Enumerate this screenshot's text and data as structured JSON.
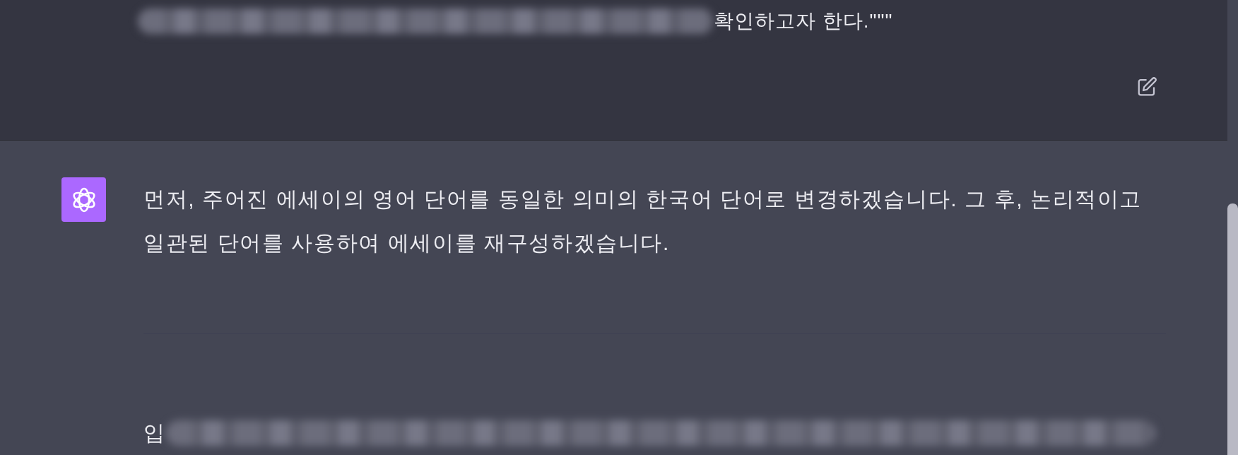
{
  "messages": [
    {
      "kind": "user",
      "text": "확인하고자 한다.\"\"\"",
      "redacted_before": true
    },
    {
      "kind": "assistant",
      "paragraphs": [
        {
          "text": "먼저, 주어진 에세이의 영어 단어를 동일한 의미의 한국어 단어로 변경하겠습니다. 그 후, 논리적이고 일관된 단어를 사용하여 에세이를 재구성하겠습니다.",
          "redacted_after": false
        },
        {
          "text": "입",
          "redacted_after": true
        }
      ]
    }
  ]
}
